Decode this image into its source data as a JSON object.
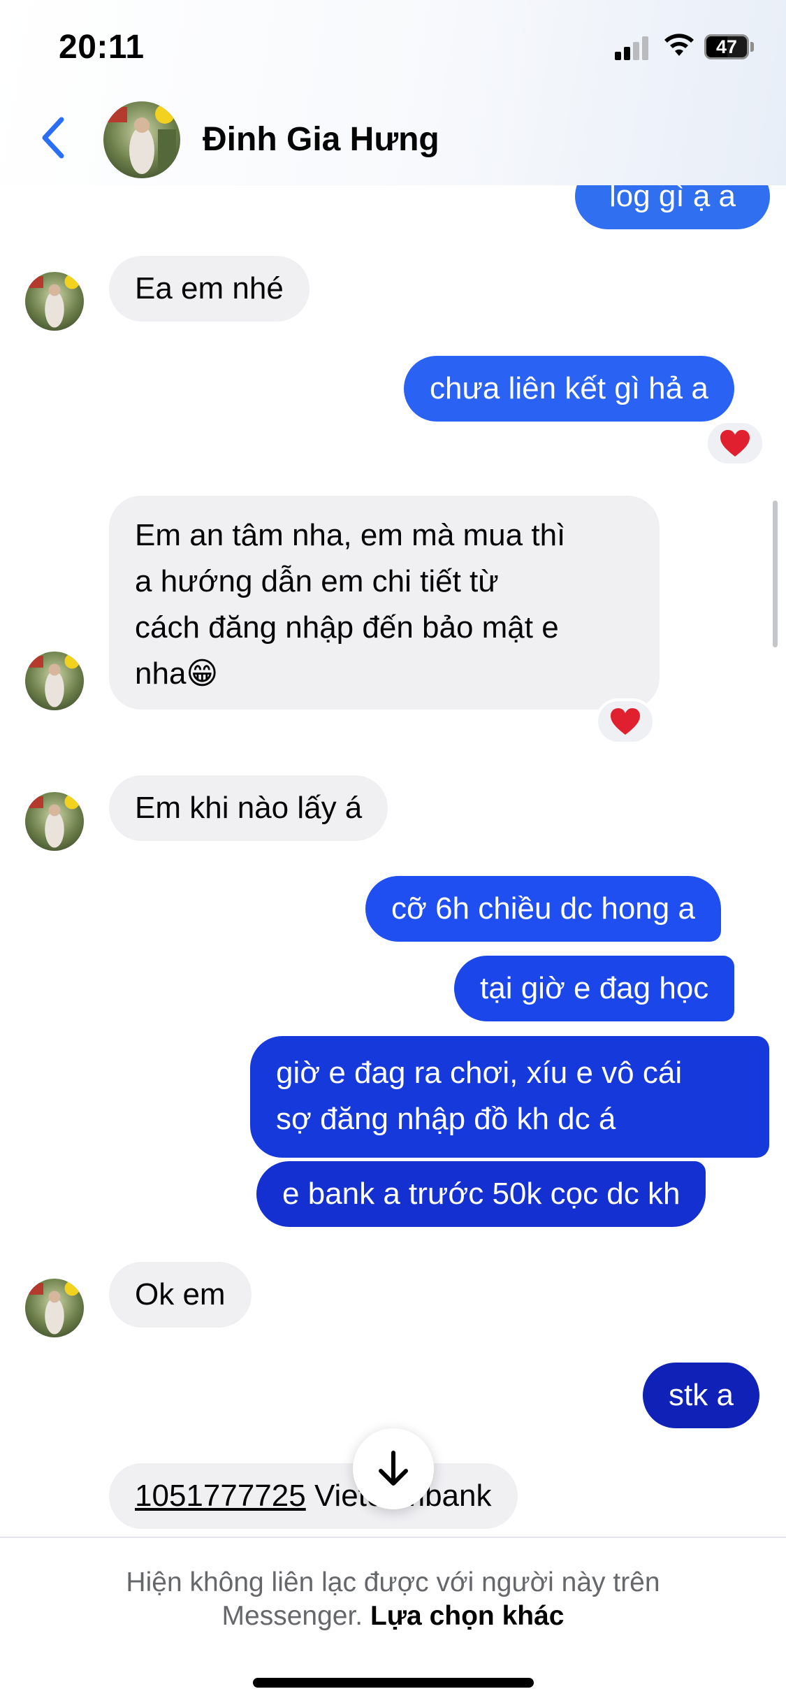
{
  "status_bar": {
    "time": "20:11",
    "battery_level": "47"
  },
  "header": {
    "contact_name": "Đinh Gia Hưng"
  },
  "messages": [
    {
      "direction": "out",
      "text": "log gì ạ a",
      "color": "#2f6ff0"
    },
    {
      "direction": "in",
      "text": "Ea em nhé"
    },
    {
      "direction": "out",
      "text": "chưa liên kết gì hả a",
      "color": "#2a63f3",
      "reaction": "❤️"
    },
    {
      "direction": "in",
      "lines": [
        "Em an tâm nha, em mà mua thì",
        "a hướng dẫn em chi tiết từ",
        "cách đăng nhập đến bảo mật e",
        "nha😁"
      ],
      "reaction": "❤️"
    },
    {
      "direction": "in",
      "text": "Em khi nào lấy á"
    },
    {
      "direction": "out",
      "text": "cỡ 6h chiều dc hong a",
      "color": "#1f4ff0"
    },
    {
      "direction": "out",
      "text": "tại giờ e đag học",
      "color": "#1a46ea"
    },
    {
      "direction": "out",
      "lines": [
        "giờ e đag ra chơi, xíu e vô cái",
        "sợ đăng nhập đồ kh dc á"
      ],
      "color": "#1639dc"
    },
    {
      "direction": "out",
      "text": "e bank a trước 50k cọc dc kh",
      "color": "#1430d0"
    },
    {
      "direction": "in",
      "text": "Ok em"
    },
    {
      "direction": "out",
      "text": "stk a",
      "color": "#0f21b6"
    },
    {
      "direction": "in",
      "account_number": "1051777725",
      "bank_text": " Vietcombank"
    }
  ],
  "footer": {
    "notice_line1": "Hiện không liên lạc được với người này trên",
    "notice_line2_prefix": "Messenger.",
    "notice_link": "Lựa chọn khác"
  },
  "icons": {
    "back": "chevron-left-icon",
    "scroll_down": "arrow-down-icon",
    "reaction": "heart-icon"
  },
  "colors": {
    "accent": "#2b6ef6",
    "incoming_bubble": "#f0f0f3"
  }
}
